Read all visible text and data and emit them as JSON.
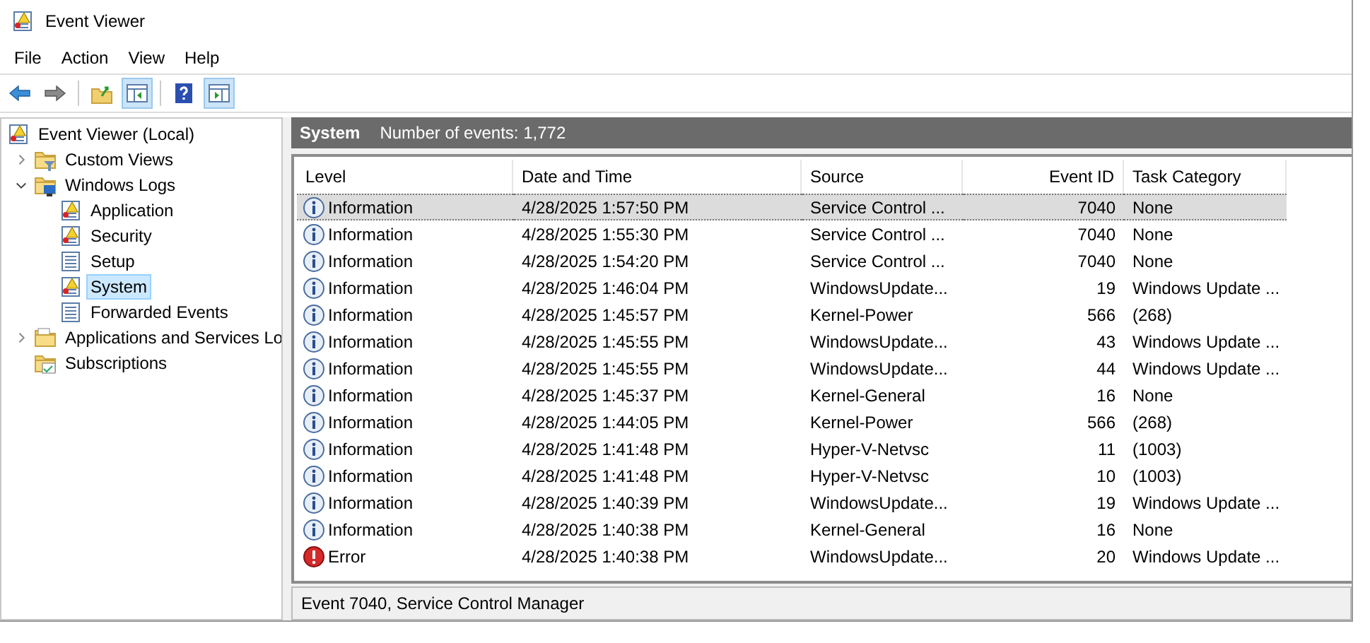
{
  "window": {
    "title": "Event Viewer"
  },
  "menu": [
    "File",
    "Action",
    "View",
    "Help"
  ],
  "toolbar": [
    {
      "kind": "back",
      "pressed": false
    },
    {
      "kind": "forward",
      "pressed": false
    },
    {
      "kind": "up",
      "pressed": false
    },
    {
      "kind": "tree-pane",
      "pressed": true
    },
    {
      "kind": "help",
      "pressed": false
    },
    {
      "kind": "action-pane",
      "pressed": true
    }
  ],
  "tree": [
    {
      "label": "Event Viewer (Local)",
      "kind": "log-warning",
      "selected": false,
      "children": [
        {
          "label": "Custom Views",
          "kind": "folder-filter",
          "selected": false,
          "expanded": false
        },
        {
          "label": "Windows Logs",
          "kind": "folder-logs",
          "selected": false,
          "expanded": true,
          "children": [
            {
              "label": "Application",
              "kind": "log-warning",
              "selected": false
            },
            {
              "label": "Security",
              "kind": "log-warning",
              "selected": false
            },
            {
              "label": "Setup",
              "kind": "log",
              "selected": false
            },
            {
              "label": "System",
              "kind": "log-warning",
              "selected": true
            },
            {
              "label": "Forwarded Events",
              "kind": "log",
              "selected": false
            }
          ]
        },
        {
          "label": "Applications and Services Lo",
          "kind": "folder",
          "selected": false,
          "expanded": false
        },
        {
          "label": "Subscriptions",
          "kind": "folder-subs",
          "selected": false
        }
      ]
    }
  ],
  "pane_header": {
    "title": "System",
    "count": "Number of events: 1,772"
  },
  "table": {
    "columns": [
      "Level",
      "Date and Time",
      "Source",
      "Event ID",
      "Task Category"
    ],
    "rows": [
      {
        "kind": "info",
        "selected": true,
        "cells": [
          "Information",
          "4/28/2025 1:57:50 PM",
          "Service Control ...",
          "7040",
          "None"
        ]
      },
      {
        "kind": "info",
        "selected": false,
        "cells": [
          "Information",
          "4/28/2025 1:55:30 PM",
          "Service Control ...",
          "7040",
          "None"
        ]
      },
      {
        "kind": "info",
        "selected": false,
        "cells": [
          "Information",
          "4/28/2025 1:54:20 PM",
          "Service Control ...",
          "7040",
          "None"
        ]
      },
      {
        "kind": "info",
        "selected": false,
        "cells": [
          "Information",
          "4/28/2025 1:46:04 PM",
          "WindowsUpdate...",
          "19",
          "Windows Update ..."
        ]
      },
      {
        "kind": "info",
        "selected": false,
        "cells": [
          "Information",
          "4/28/2025 1:45:57 PM",
          "Kernel-Power",
          "566",
          "(268)"
        ]
      },
      {
        "kind": "info",
        "selected": false,
        "cells": [
          "Information",
          "4/28/2025 1:45:55 PM",
          "WindowsUpdate...",
          "43",
          "Windows Update ..."
        ]
      },
      {
        "kind": "info",
        "selected": false,
        "cells": [
          "Information",
          "4/28/2025 1:45:55 PM",
          "WindowsUpdate...",
          "44",
          "Windows Update ..."
        ]
      },
      {
        "kind": "info",
        "selected": false,
        "cells": [
          "Information",
          "4/28/2025 1:45:37 PM",
          "Kernel-General",
          "16",
          "None"
        ]
      },
      {
        "kind": "info",
        "selected": false,
        "cells": [
          "Information",
          "4/28/2025 1:44:05 PM",
          "Kernel-Power",
          "566",
          "(268)"
        ]
      },
      {
        "kind": "info",
        "selected": false,
        "cells": [
          "Information",
          "4/28/2025 1:41:48 PM",
          "Hyper-V-Netvsc",
          "11",
          "(1003)"
        ]
      },
      {
        "kind": "info",
        "selected": false,
        "cells": [
          "Information",
          "4/28/2025 1:41:48 PM",
          "Hyper-V-Netvsc",
          "10",
          "(1003)"
        ]
      },
      {
        "kind": "info",
        "selected": false,
        "cells": [
          "Information",
          "4/28/2025 1:40:39 PM",
          "WindowsUpdate...",
          "19",
          "Windows Update ..."
        ]
      },
      {
        "kind": "info",
        "selected": false,
        "cells": [
          "Information",
          "4/28/2025 1:40:38 PM",
          "Kernel-General",
          "16",
          "None"
        ]
      },
      {
        "kind": "error",
        "selected": false,
        "cells": [
          "Error",
          "4/28/2025 1:40:38 PM",
          "WindowsUpdate...",
          "20",
          "Windows Update ..."
        ]
      }
    ]
  },
  "status_bar": "Event 7040, Service Control Manager"
}
